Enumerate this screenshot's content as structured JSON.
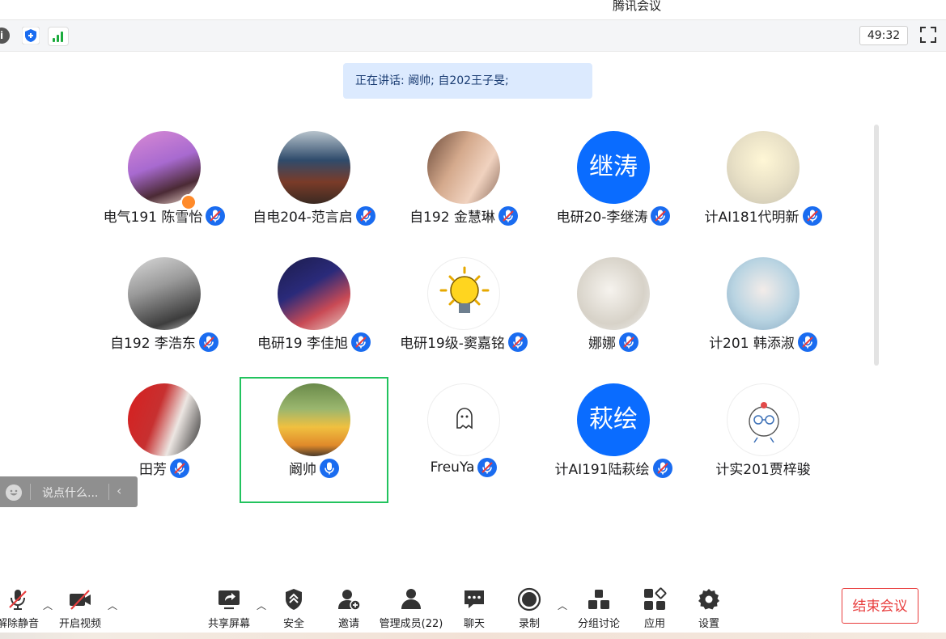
{
  "window": {
    "title": "腾讯会议"
  },
  "toolbar_top": {
    "timer": "49:32"
  },
  "speaking": {
    "text": "正在讲话: 阚帅; 自202王子旻;"
  },
  "participants": [
    {
      "name": "电气191 陈雪怡"
    },
    {
      "name": "自电204-范言启"
    },
    {
      "name": "自192 金慧琳"
    },
    {
      "name": "电研20-李继涛",
      "avatar_text": "继涛"
    },
    {
      "name": "计AI181代明新"
    },
    {
      "name": "自192 李浩东"
    },
    {
      "name": "电研19 李佳旭"
    },
    {
      "name": "电研19级-窦嘉铭"
    },
    {
      "name": "娜娜"
    },
    {
      "name": "计201 韩添淑"
    },
    {
      "name": "田芳"
    },
    {
      "name": "阚帅"
    },
    {
      "name": "FreuYa"
    },
    {
      "name": "计AI191陆萩绘",
      "avatar_text": "萩绘"
    },
    {
      "name": "计实201贾梓骏"
    }
  ],
  "chat": {
    "placeholder": "说点什么..."
  },
  "bottom_toolbar": {
    "unmute": "解除静音",
    "video": "开启视频",
    "share": "共享屏幕",
    "security": "安全",
    "invite": "邀请",
    "members": "管理成员(22)",
    "chat": "聊天",
    "record": "录制",
    "breakout": "分组讨论",
    "apps": "应用",
    "settings": "设置",
    "end": "结束会议"
  },
  "colors": {
    "accent": "#0a6cff",
    "active_border": "#22c35e",
    "end_red": "#e83d3d",
    "banner_bg": "#dceafe"
  },
  "icons": [
    "info-icon",
    "shield-icon",
    "signal-icon",
    "fullscreen-icon",
    "mic-muted-icon",
    "mic-active-icon",
    "emoji-icon",
    "share-screen-icon",
    "security-icon",
    "invite-icon",
    "members-icon",
    "chat-icon",
    "record-icon",
    "breakout-icon",
    "apps-icon",
    "settings-icon",
    "video-off-icon",
    "mic-off-icon"
  ]
}
